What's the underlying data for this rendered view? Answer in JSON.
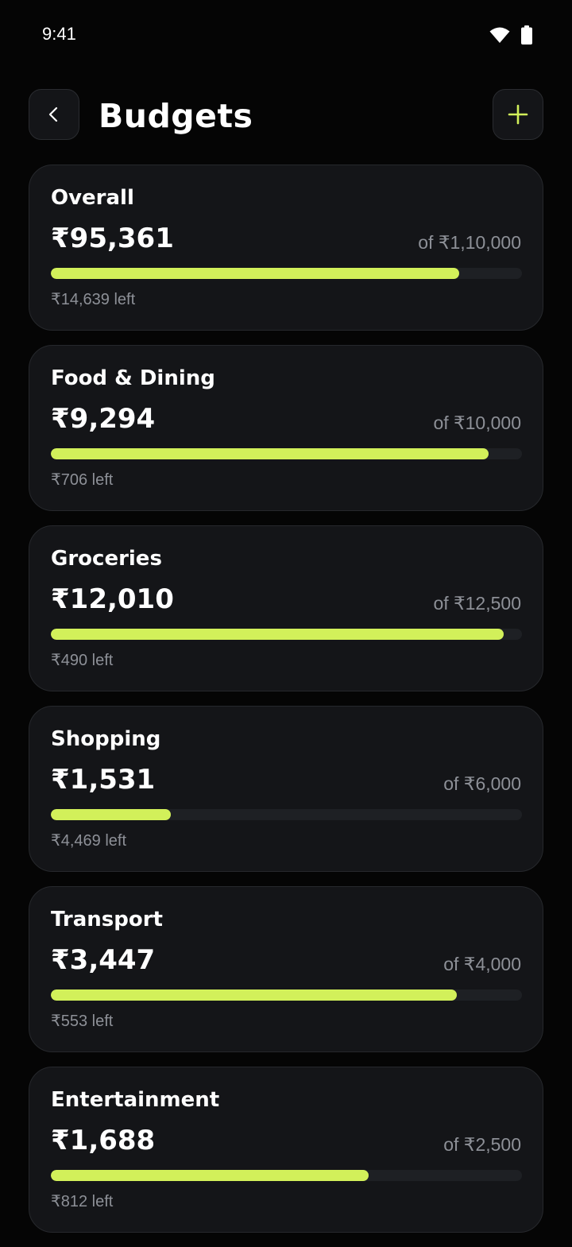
{
  "status": {
    "time": "9:41"
  },
  "header": {
    "title": "Budgets"
  },
  "colors": {
    "accent": "#d2f05a",
    "background": "#050505",
    "card": "#141518",
    "track": "#1e2024",
    "muted": "#8d9097"
  },
  "icons": {
    "back": "chevron-left-icon",
    "add": "plus-icon",
    "wifi": "wifi-icon",
    "battery": "battery-icon"
  },
  "budgets": [
    {
      "name": "Overall",
      "spent": "₹95,361",
      "limit": "of ₹1,10,000",
      "left": "₹14,639 left",
      "progress": 0.867
    },
    {
      "name": "Food & Dining",
      "spent": "₹9,294",
      "limit": "of ₹10,000",
      "left": "₹706 left",
      "progress": 0.929
    },
    {
      "name": "Groceries",
      "spent": "₹12,010",
      "limit": "of ₹12,500",
      "left": "₹490 left",
      "progress": 0.961
    },
    {
      "name": "Shopping",
      "spent": "₹1,531",
      "limit": "of ₹6,000",
      "left": "₹4,469 left",
      "progress": 0.255
    },
    {
      "name": "Transport",
      "spent": "₹3,447",
      "limit": "of ₹4,000",
      "left": "₹553 left",
      "progress": 0.862
    },
    {
      "name": "Entertainment",
      "spent": "₹1,688",
      "limit": "of ₹2,500",
      "left": "₹812 left",
      "progress": 0.675
    }
  ]
}
